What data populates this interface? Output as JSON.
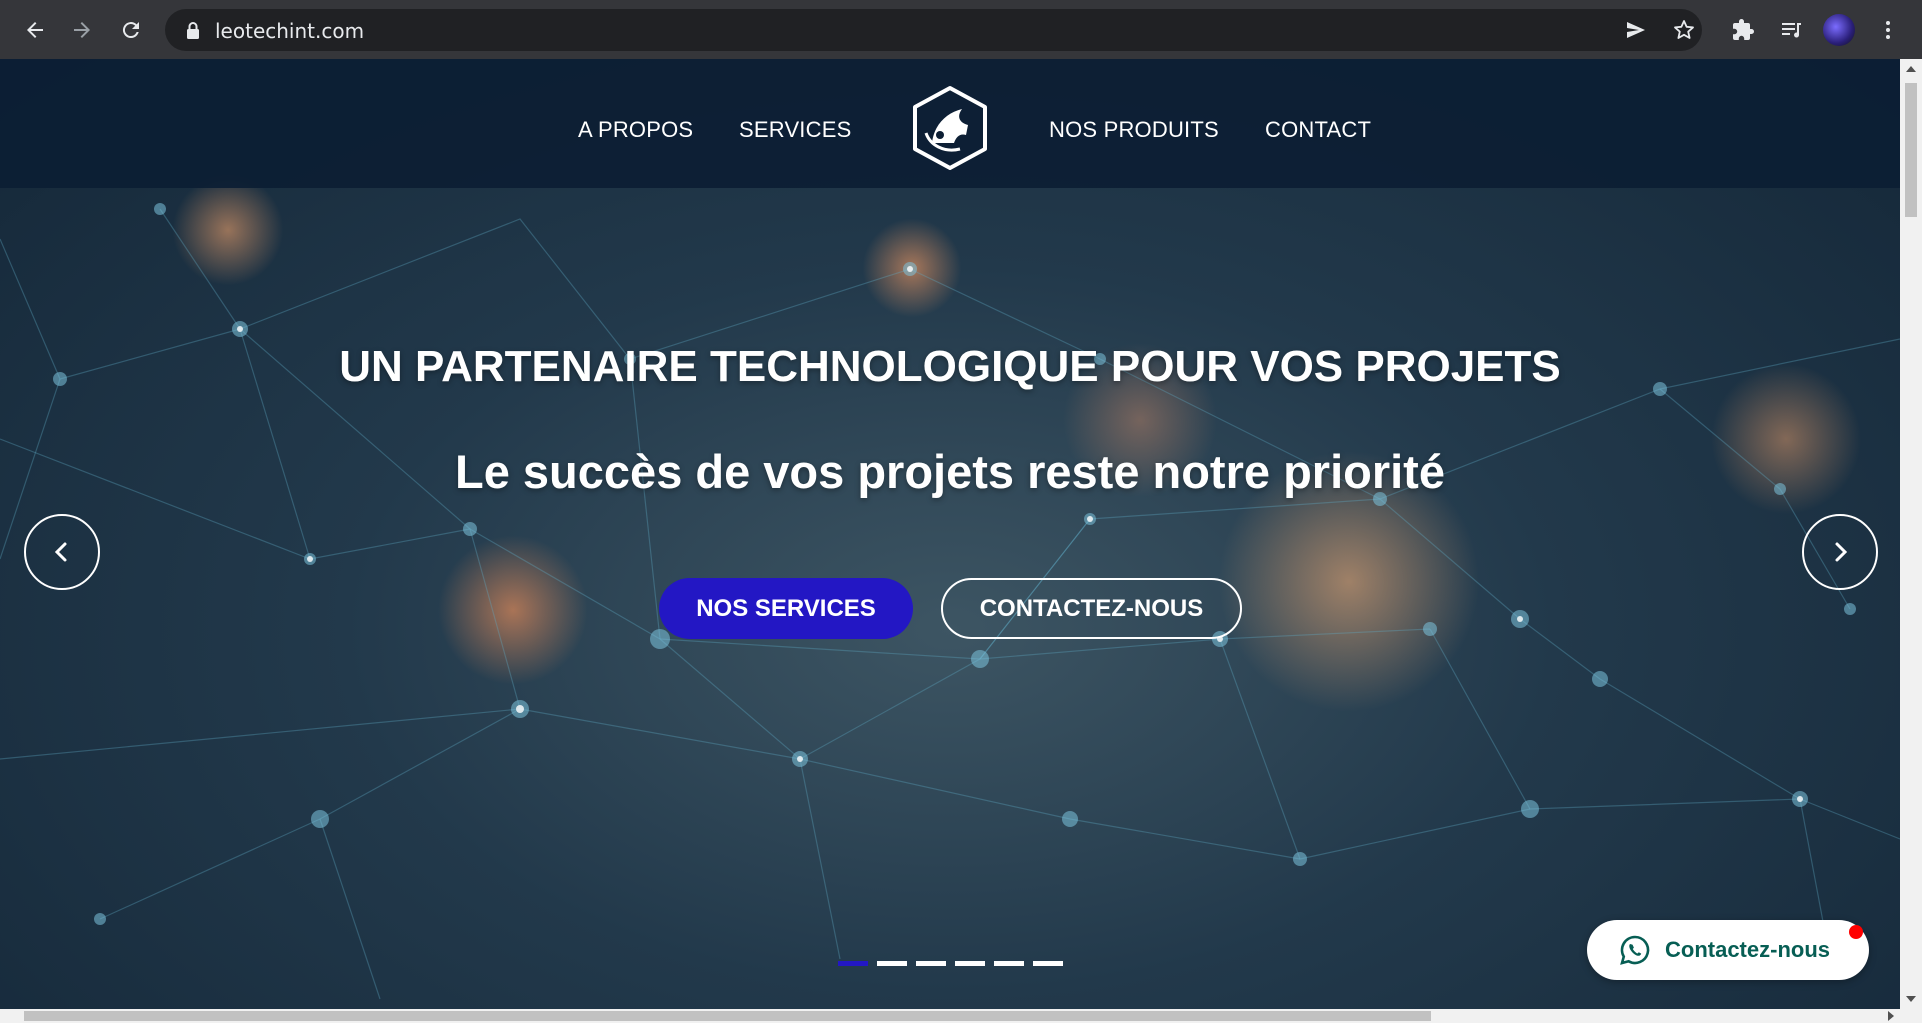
{
  "browser": {
    "url": "leotechint.com"
  },
  "site": {
    "menu": {
      "about": "A PROPOS",
      "services": "SERVICES",
      "products": "NOS PRODUITS",
      "contact": "CONTACT"
    },
    "hero": {
      "title": "UN PARTENAIRE TECHNOLOGIQUE POUR VOS PROJETS",
      "subtitle": "Le succès de vos projets reste notre priorité",
      "primary_button": "NOS SERVICES",
      "secondary_button": "CONTACTEZ-NOUS",
      "slides_count": 6,
      "active_slide": 1
    },
    "whatsapp": {
      "label": "Contactez-nous"
    }
  },
  "colors": {
    "header_bg": "#0c1e34",
    "primary_button": "#2317c4",
    "whatsapp_text": "#075e54",
    "notification": "#ff0000"
  },
  "icons": [
    "back-arrow-icon",
    "forward-arrow-icon",
    "reload-icon",
    "lock-icon",
    "send-icon",
    "star-icon",
    "puzzle-icon",
    "media-queue-icon",
    "kebab-menu-icon",
    "chevron-left-icon",
    "chevron-right-icon",
    "whatsapp-icon"
  ]
}
